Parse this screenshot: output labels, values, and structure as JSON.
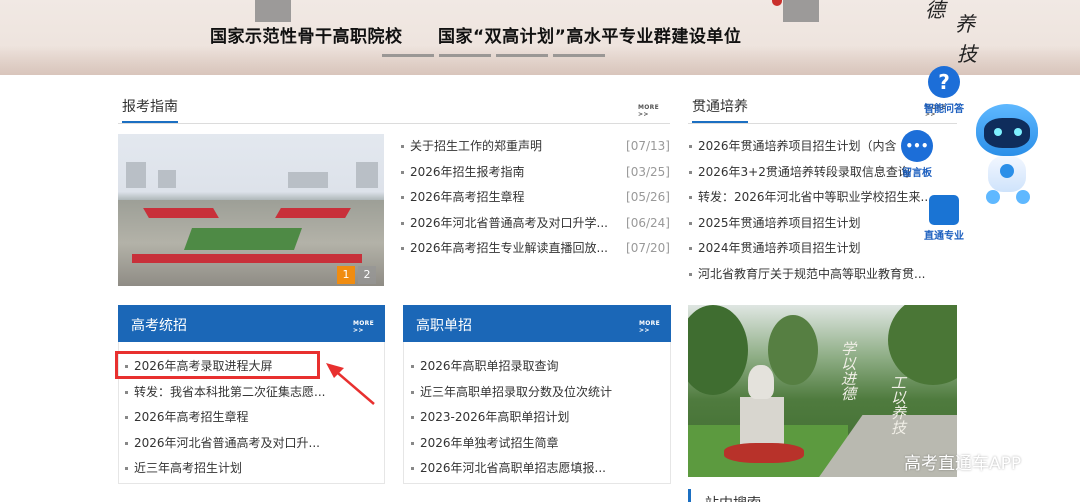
{
  "banner": {
    "slogan1": "国家示范性骨干高职院校",
    "slogan2": "国家“双高计划”高水平专业群建设单位",
    "calligraphy": [
      "德",
      "养",
      "技"
    ]
  },
  "guide": {
    "title": "报考指南",
    "more": "MORE >>",
    "pager": [
      "1",
      "2"
    ],
    "items": [
      {
        "text": "关于招生工作的郑重声明",
        "date": "[07/13]"
      },
      {
        "text": "2026年招生报考指南",
        "date": "[03/25]"
      },
      {
        "text": "2026年高考招生章程",
        "date": "[05/26]"
      },
      {
        "text": "2026年河北省普通高考及对口升学...",
        "date": "[06/24]"
      },
      {
        "text": "2026年高考招生专业解读直播回放...",
        "date": "[07/20]"
      }
    ]
  },
  "through": {
    "title": "贯通培养",
    "more": "MORE >>",
    "items": [
      "2026年贯通培养项目招生计划（内含",
      "2026年3+2贯通培养转段录取信息查询",
      "转发：2026年河北省中等职业学校招生来...",
      "2025年贯通培养项目招生计划",
      "2024年贯通培养项目招生计划",
      "河北省教育厅关于规范中高等职业教育贯..."
    ]
  },
  "gaokao": {
    "title": "高考统招",
    "more": "MORE >>",
    "items": [
      "2026年高考录取进程大屏",
      "转发：我省本科批第二次征集志愿...",
      "2026年高考招生章程",
      "2026年河北省普通高考及对口升...",
      "近三年高考招生计划"
    ]
  },
  "danzhao": {
    "title": "高职单招",
    "more": "MORE >>",
    "items": [
      "2026年高职单招录取查询",
      "近三年高职单招录取分数及位次统计",
      "2023-2026年高职单招计划",
      "2026年单独考试招生简章",
      "2026年河北省高职单招志愿填报..."
    ]
  },
  "photo2": {
    "engrave1": "学以进德",
    "engrave2": "工以养技"
  },
  "float": {
    "qa_label": "智能问答",
    "qa_icon_glyph": "?",
    "msg_label": "留言板",
    "msg_icon_glyph": "•••",
    "major_label": "直通专业"
  },
  "watermark": "高考直通车APP",
  "bottom": {
    "title": "站内搜索"
  },
  "colors": {
    "accent": "#1b67b7",
    "highlight": "#e8302f",
    "pager_active": "#f08c10"
  }
}
